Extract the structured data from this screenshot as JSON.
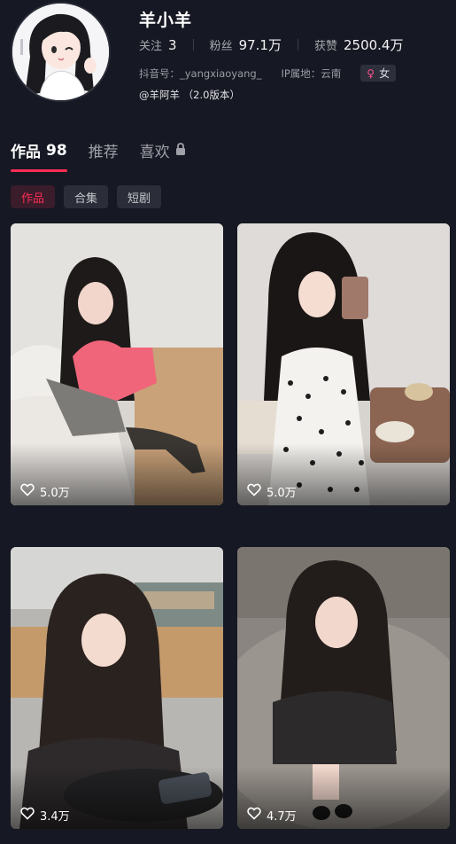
{
  "profile": {
    "name": "羊小羊",
    "stats": [
      {
        "label": "关注",
        "value": "3"
      },
      {
        "label": "粉丝",
        "value": "97.1万"
      },
      {
        "label": "获赞",
        "value": "2500.4万"
      }
    ],
    "douyin_id": "抖音号：_yangxiaoyang_",
    "ip_location": "IP属地：云南",
    "gender": "女",
    "bio": "@羊阿羊 （2.0版本）"
  },
  "tabs": [
    {
      "label": "作品",
      "count": "98"
    },
    {
      "label": "推荐"
    },
    {
      "label": "喜欢"
    }
  ],
  "subtabs": [
    "作品",
    "合集",
    "短剧"
  ],
  "videos": [
    {
      "likes": "5.0万"
    },
    {
      "likes": "5.0万"
    },
    {
      "likes": "3.4万"
    },
    {
      "likes": "4.7万"
    }
  ],
  "colors": {
    "background": "#161823",
    "accent": "#fe2c55",
    "gender_pink": "#ff4f8b"
  },
  "icons": {
    "lock": "lock-icon",
    "heart": "heart-icon",
    "female": "female-symbol-icon"
  }
}
